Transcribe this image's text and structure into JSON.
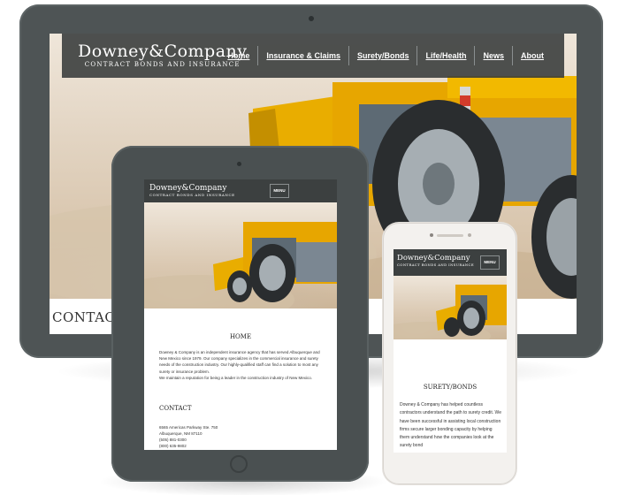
{
  "brand": {
    "name": "Downey&Company",
    "tagline": "Contract Bonds and Insurance"
  },
  "desktop": {
    "nav": [
      {
        "label": "Home"
      },
      {
        "label": "Insurance & Claims"
      },
      {
        "label": "Surety/Bonds"
      },
      {
        "label": "Life/Health"
      },
      {
        "label": "News"
      },
      {
        "label": "About"
      }
    ],
    "contact_heading": "CONTACT"
  },
  "tablet": {
    "menu_label": "MENU",
    "home_heading": "HOME",
    "intro_paragraph": "Downey & Company is an independent insurance agency that has served Albuquerque and New Mexico since 1979. Our company specializes in the commercial insurance and surety needs of the construction industry. Our highly-qualified staff can find a solution to most any surety or insurance problem.",
    "intro_paragraph_2": "We maintain a reputation for being a leader in the construction industry of New Mexico.",
    "contact_heading": "CONTACT",
    "address_line_1": "6565 Americas Parkway Ste. 750",
    "address_line_2": "Albuquerque, NM 87110",
    "phone_1": "(505) 881-0300",
    "phone_2": "(800) 635-9802"
  },
  "phone": {
    "menu_label": "MENU",
    "section_heading": "SURETY/BONDS",
    "paragraph": "Downey & Company has helped countless contractors understand the path to surety credit. We have been successful in assisting local construction firms secure larger bonding capacity by helping them understand how the companies look at the surety bond"
  },
  "colors": {
    "header_bg": "#3c4040",
    "device_dark": "#4e5455",
    "loader_yellow": "#f5b800"
  }
}
